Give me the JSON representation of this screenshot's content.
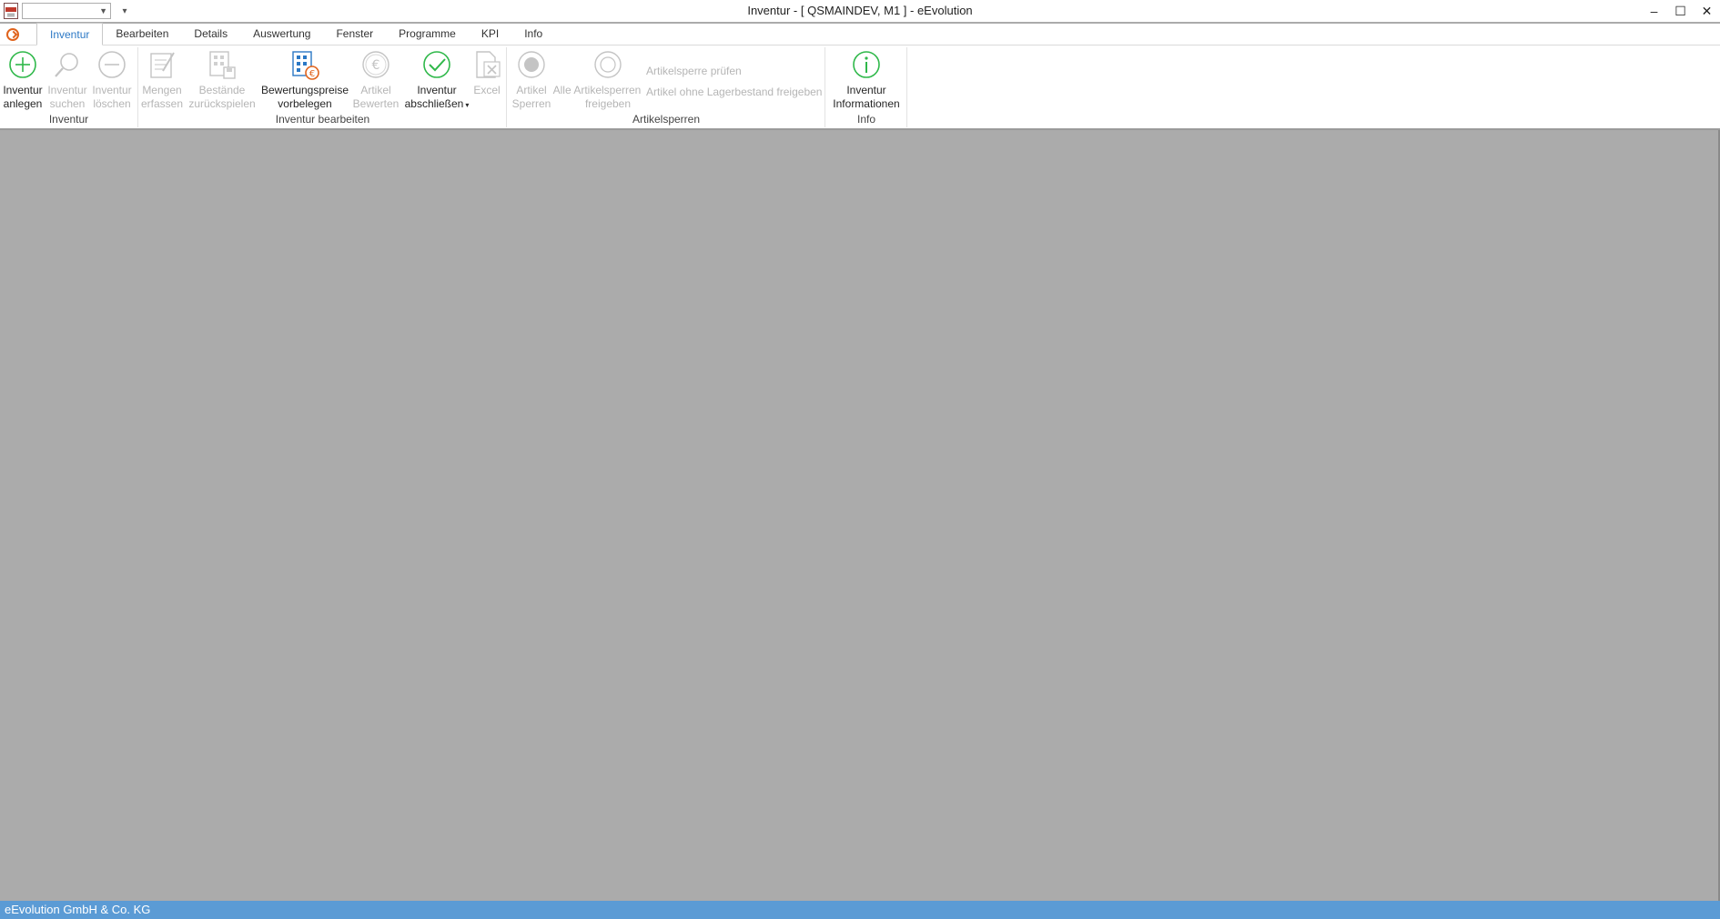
{
  "window": {
    "title": "Inventur - [ QSMAINDEV, M1 ]  -  eEvolution",
    "controls": {
      "minimize": "–",
      "maximize": "☐",
      "close": "✕"
    }
  },
  "quick_access": {
    "combo_value": "",
    "customize_glyph": "▾"
  },
  "tabs": [
    {
      "label": "Inventur",
      "active": true
    },
    {
      "label": "Bearbeiten",
      "active": false
    },
    {
      "label": "Details",
      "active": false
    },
    {
      "label": "Auswertung",
      "active": false
    },
    {
      "label": "Fenster",
      "active": false
    },
    {
      "label": "Programme",
      "active": false
    },
    {
      "label": "KPI",
      "active": false
    },
    {
      "label": "Info",
      "active": false
    }
  ],
  "ribbon": {
    "groups": {
      "inventur": {
        "label": "Inventur",
        "anlegen": {
          "line1": "Inventur",
          "line2": "anlegen",
          "icon": "plus-circle-icon",
          "enabled": true
        },
        "suchen": {
          "line1": "Inventur",
          "line2": "suchen",
          "icon": "magnifier-icon",
          "enabled": false
        },
        "loeschen": {
          "line1": "Inventur",
          "line2": "löschen",
          "icon": "minus-circle-icon",
          "enabled": false
        }
      },
      "bearbeiten": {
        "label": "Inventur bearbeiten",
        "mengen": {
          "line1": "Mengen",
          "line2": "erfassen",
          "icon": "notepad-pencil-icon",
          "enabled": false
        },
        "bestaende": {
          "line1": "Bestände",
          "line2": "zurückspielen",
          "icon": "building-disk-icon",
          "enabled": false
        },
        "bewertungspreise": {
          "line1": "Bewertungspreise",
          "line2": "vorbelegen",
          "icon": "building-euro-icon",
          "enabled": true
        },
        "artikel_bewerten": {
          "line1": "Artikel",
          "line2": "Bewerten",
          "icon": "euro-coin-icon",
          "enabled": false
        },
        "abschliessen": {
          "line1": "Inventur",
          "line2": "abschließen",
          "icon": "checkmark-circle-icon",
          "enabled": true,
          "dropdown": "▾"
        },
        "excel": {
          "line1": "Excel",
          "icon": "excel-document-icon",
          "enabled": false
        }
      },
      "artikelsperren": {
        "label": "Artikelsperren",
        "sperren": {
          "line1": "Artikel",
          "line2": "Sperren",
          "icon": "lock-dot-icon",
          "enabled": false
        },
        "alle_freigeben": {
          "line1_prefix": "Alle",
          "line1": "Artikelsperren",
          "line2": "freigeben",
          "icon": "unlock-circle-icon",
          "enabled": false
        },
        "pruefen": {
          "label": "Artikelsperre prüfen",
          "enabled": false
        },
        "ohne_lager": {
          "label": "Artikel ohne Lagerbestand freigeben",
          "enabled": false
        }
      },
      "info": {
        "label": "Info",
        "informationen": {
          "line1": "Inventur",
          "line2": "Informationen",
          "icon": "info-circle-icon",
          "enabled": true
        }
      }
    }
  },
  "statusbar": {
    "text": "eEvolution GmbH & Co. KG"
  },
  "colors": {
    "accent": "#2b78c5",
    "green": "#2fb84a",
    "orange": "#e0631c",
    "status": "#5b9bd5",
    "workspace": "#ababab"
  }
}
